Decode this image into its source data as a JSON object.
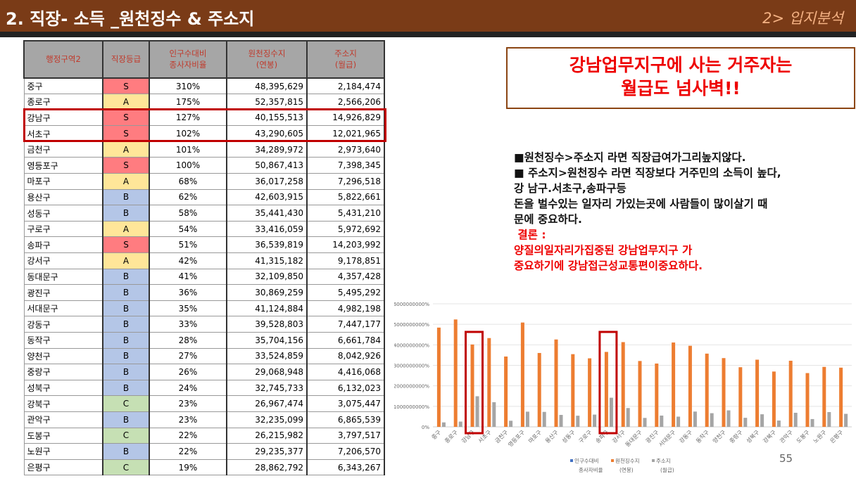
{
  "header": {
    "title": "2. 직장- 소득 _원천징수 & 주소지",
    "section": "2> 입지분석"
  },
  "table": {
    "headers": [
      "행정구역2",
      "직장등급",
      "인구수대비\n종사자비율",
      "원천징수지\n(연봉)",
      "주소지\n(월급)"
    ],
    "rows": [
      [
        "중구",
        "S",
        "310%",
        "48,395,629",
        "2,184,474"
      ],
      [
        "종로구",
        "A",
        "175%",
        "52,357,815",
        "2,566,206"
      ],
      [
        "강남구",
        "S",
        "127%",
        "40,155,513",
        "14,926,829"
      ],
      [
        "서초구",
        "S",
        "102%",
        "43,290,605",
        "12,021,965"
      ],
      [
        "금천구",
        "A",
        "101%",
        "34,289,972",
        "2,973,640"
      ],
      [
        "영등포구",
        "S",
        "100%",
        "50,867,413",
        "7,398,345"
      ],
      [
        "마포구",
        "A",
        "68%",
        "36,017,258",
        "7,296,518"
      ],
      [
        "용산구",
        "B",
        "62%",
        "42,603,915",
        "5,822,661"
      ],
      [
        "성동구",
        "B",
        "58%",
        "35,441,430",
        "5,431,210"
      ],
      [
        "구로구",
        "A",
        "54%",
        "33,416,059",
        "5,972,692"
      ],
      [
        "송파구",
        "S",
        "51%",
        "36,539,819",
        "14,203,992"
      ],
      [
        "강서구",
        "A",
        "42%",
        "41,315,182",
        "9,178,851"
      ],
      [
        "동대문구",
        "B",
        "41%",
        "32,109,850",
        "4,357,428"
      ],
      [
        "광진구",
        "B",
        "36%",
        "30,869,259",
        "5,495,292"
      ],
      [
        "서대문구",
        "B",
        "35%",
        "41,124,884",
        "4,982,198"
      ],
      [
        "강동구",
        "B",
        "33%",
        "39,528,803",
        "7,447,177"
      ],
      [
        "동작구",
        "B",
        "28%",
        "35,704,156",
        "6,661,784"
      ],
      [
        "양천구",
        "B",
        "27%",
        "33,524,859",
        "8,042,926"
      ],
      [
        "중랑구",
        "B",
        "26%",
        "29,068,948",
        "4,416,068"
      ],
      [
        "성북구",
        "B",
        "24%",
        "32,745,733",
        "6,132,023"
      ],
      [
        "강북구",
        "C",
        "23%",
        "26,967,474",
        "3,075,447"
      ],
      [
        "관악구",
        "B",
        "23%",
        "32,235,099",
        "6,865,539"
      ],
      [
        "도봉구",
        "C",
        "22%",
        "26,215,982",
        "3,797,517"
      ],
      [
        "노원구",
        "B",
        "22%",
        "29,235,377",
        "7,206,570"
      ],
      [
        "은평구",
        "C",
        "19%",
        "28,862,792",
        "6,343,267"
      ]
    ]
  },
  "grade_colors": {
    "S": "#ff7c80",
    "A": "#ffe699",
    "B": "#b4c6e7",
    "C": "#c6e0b4"
  },
  "callout": {
    "line1": "강남업무지구에 사는 거주자는",
    "line2": "월급도 넘사벽!!"
  },
  "notes": {
    "l1": "■원천징수>주소지 라면 직장급여가그리높지않다.",
    "l2": "■ 주소지>원천징수 라면 직장보다 거주민의 소득이 높다,",
    "l3": "강 남구.서초구,송파구등",
    "l4": "돈을 벌수있는 일자리 가있는곳에  사람들이 많이살기 때",
    "l5": "문에 중요하다.",
    "l6": " 결론 :",
    "l7": "양질의일자리가집중된 강남업무지구 가",
    "l8": "중요하기에 강남접근성교통편이중요하다."
  },
  "page_number": "55",
  "chart_data": {
    "type": "bar",
    "categories": [
      "중구",
      "종로구",
      "강남구",
      "서초구",
      "금천구",
      "영등포구",
      "마포구",
      "용산구",
      "성동구",
      "구로구",
      "송파구",
      "강서구",
      "동대문구",
      "광진구",
      "서대문구",
      "강동구",
      "동작구",
      "양천구",
      "중랑구",
      "성북구",
      "강북구",
      "관악구",
      "도봉구",
      "노원구",
      "은평구"
    ],
    "yticks": [
      "0%",
      "1000000000%",
      "2000000000%",
      "3000000000%",
      "4000000000%",
      "5000000000%",
      "6000000000%"
    ],
    "ylim": [
      0,
      60000000
    ],
    "series": [
      {
        "name": "인구수대비\n종사자비율",
        "color": "#4472c4",
        "values": [
          3.1,
          1.75,
          1.27,
          1.02,
          1.01,
          1,
          0.68,
          0.62,
          0.58,
          0.54,
          0.51,
          0.42,
          0.41,
          0.36,
          0.35,
          0.33,
          0.28,
          0.27,
          0.26,
          0.24,
          0.23,
          0.23,
          0.22,
          0.22,
          0.19
        ]
      },
      {
        "name": "원천징수지\n(연봉)",
        "color": "#ed7d31",
        "values": [
          48395629,
          52357815,
          40155513,
          43290605,
          34289972,
          50867413,
          36017258,
          42603915,
          35441430,
          33416059,
          36539819,
          41315182,
          32109850,
          30869259,
          41124884,
          39528803,
          35704156,
          33524859,
          29068948,
          32745733,
          26967474,
          32235099,
          26215982,
          29235377,
          28862792
        ]
      },
      {
        "name": "주소지\n(월급)",
        "color": "#a5a5a5",
        "values": [
          2184474,
          2566206,
          14926829,
          12021965,
          2973640,
          7398345,
          7296518,
          5822661,
          5431210,
          5972692,
          14203992,
          9178851,
          4357428,
          5495292,
          4982198,
          7447177,
          6661784,
          8042926,
          4416068,
          6132023,
          3075447,
          6865539,
          3797517,
          7206570,
          6343267
        ]
      }
    ],
    "highlighted": [
      "강남구",
      "송파구"
    ]
  }
}
